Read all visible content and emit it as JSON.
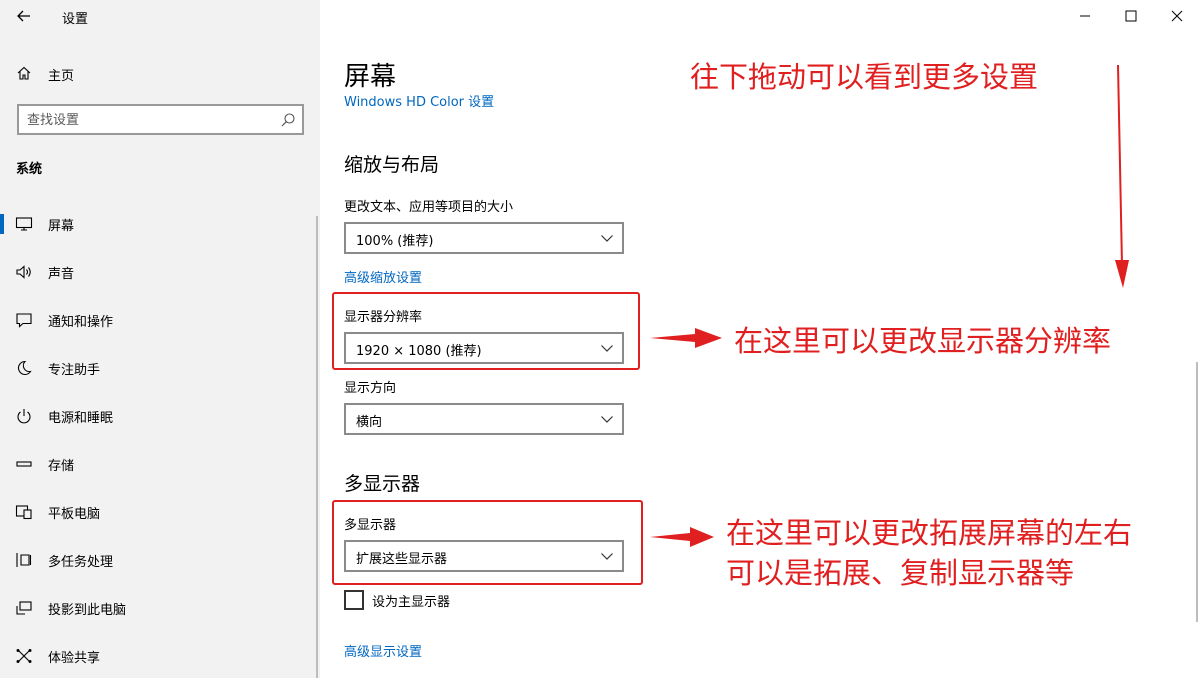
{
  "window": {
    "title": "设置",
    "controls": {
      "minimize": "—",
      "maximize": "☐",
      "close": "✕"
    }
  },
  "sidebar": {
    "home_label": "主页",
    "search_placeholder": "查找设置",
    "section": "系统",
    "items": [
      {
        "label": "屏幕",
        "icon": "monitor-icon",
        "active": true
      },
      {
        "label": "声音",
        "icon": "speaker-icon"
      },
      {
        "label": "通知和操作",
        "icon": "notification-icon"
      },
      {
        "label": "专注助手",
        "icon": "moon-icon"
      },
      {
        "label": "电源和睡眠",
        "icon": "power-icon"
      },
      {
        "label": "存储",
        "icon": "storage-icon"
      },
      {
        "label": "平板电脑",
        "icon": "tablet-icon"
      },
      {
        "label": "多任务处理",
        "icon": "multitask-icon"
      },
      {
        "label": "投影到此电脑",
        "icon": "project-icon"
      },
      {
        "label": "体验共享",
        "icon": "share-icon"
      }
    ]
  },
  "main": {
    "title": "屏幕",
    "hd_color_link": "Windows HD Color 设置",
    "scale_layout": {
      "heading": "缩放与布局",
      "text_size_label": "更改文本、应用等项目的大小",
      "text_size_value": "100% (推荐)",
      "advanced_scaling_link": "高级缩放设置",
      "resolution_label": "显示器分辨率",
      "resolution_value": "1920 × 1080 (推荐)",
      "orientation_label": "显示方向",
      "orientation_value": "横向"
    },
    "multi_display": {
      "heading": "多显示器",
      "label": "多显示器",
      "value": "扩展这些显示器",
      "primary_checkbox_label": "设为主显示器",
      "primary_checked": false
    },
    "advanced_display_link": "高级显示设置"
  },
  "annotations": {
    "scroll_hint": "往下拖动可以看到更多设置",
    "resolution_hint": "在这里可以更改显示器分辨率",
    "multi_hint_line1": "在这里可以更改拓展屏幕的左右",
    "multi_hint_line2": "可以是拓展、复制显示器等",
    "color": "#e02020"
  },
  "colors": {
    "accent": "#0067c0",
    "sidebar_bg": "#f2f2f2"
  }
}
